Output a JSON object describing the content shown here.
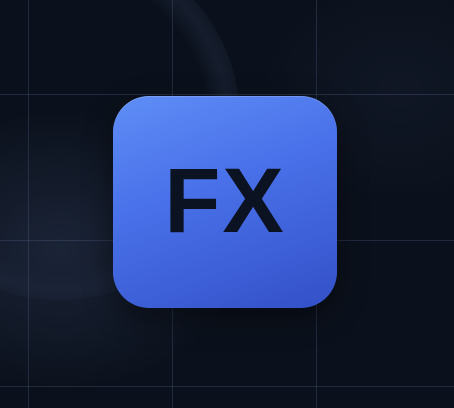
{
  "app_icon": {
    "label": "FX",
    "gradient_top": "#5f8ef6",
    "gradient_bottom": "#3350c8",
    "text_color": "#0b1222"
  },
  "background": {
    "color": "#0b111c",
    "grid_color": "#5a6e96"
  }
}
